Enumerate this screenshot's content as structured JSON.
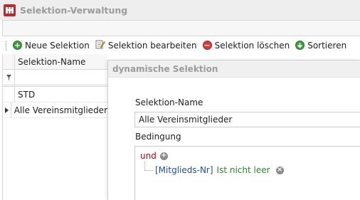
{
  "window": {
    "title": "Selektion-Verwaltung"
  },
  "toolbar": {
    "new_label": "Neue Selektion",
    "edit_label": "Selektion bearbeiten",
    "delete_label": "Selektion löschen",
    "sort_label": "Sortieren"
  },
  "grid": {
    "column_header": "Selektion-Name",
    "rows": [
      {
        "name": "STD",
        "selected": false
      },
      {
        "name": "Alle Vereinsmitglieder",
        "selected": true
      }
    ]
  },
  "dialog": {
    "title": "dynamische Selektion",
    "name_label": "Selektion-Name",
    "name_value": "Alle Vereinsmitglieder",
    "condition_label": "Bedingung",
    "condition": {
      "operator": "und",
      "field": "[Mitglieds-Nr]",
      "comparison": "Ist nicht leer"
    }
  },
  "colors": {
    "operator": "#c00000",
    "field": "#1f4e9e",
    "comparison": "#2a8a2a",
    "app_icon": "#c1272d"
  },
  "icons": [
    "app-icon",
    "add-icon",
    "edit-icon",
    "delete-icon",
    "sort-icon",
    "filter-icon",
    "row-pointer-icon",
    "add-condition-icon",
    "remove-condition-icon"
  ]
}
